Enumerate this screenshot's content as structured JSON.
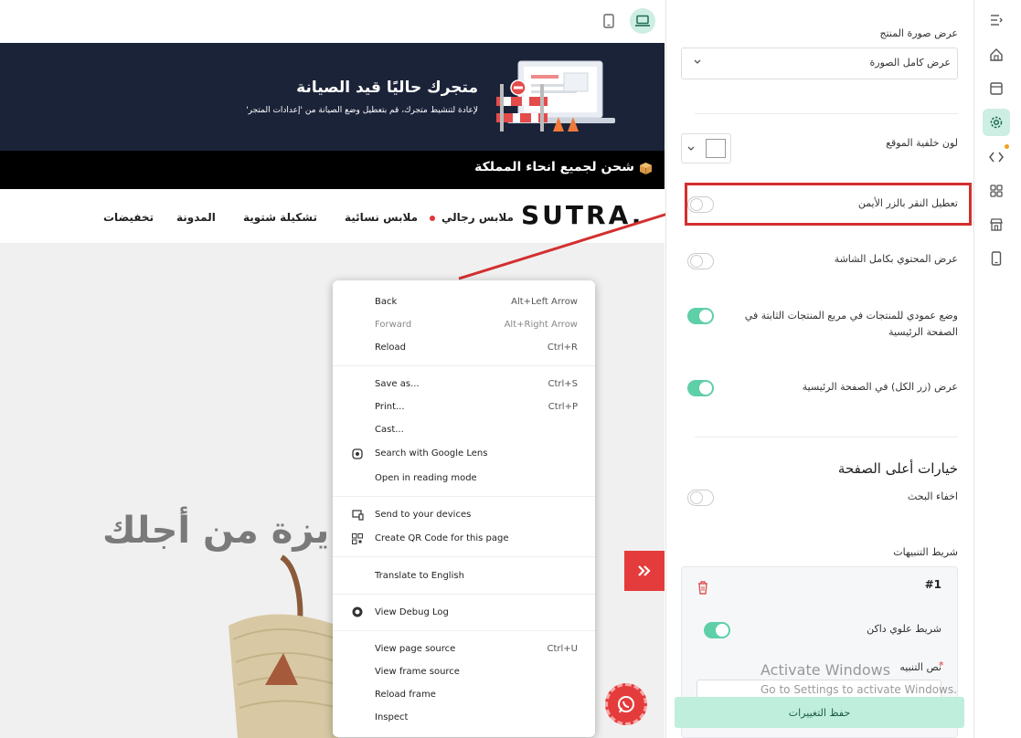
{
  "preview": {
    "maintenance": {
      "title": "متجرك حاليًا قيد الصيانة",
      "subtitle": "لإعادة لتنشيط متجرك، قم بتعطيل وضع الصيانة من 'إعدادات المتجر'"
    },
    "shipping_bar": {
      "text": "شحن لجميع انحاء المملكة",
      "icon": "box-icon"
    },
    "logo": "SUTRA.",
    "nav": [
      "ملابس رجالي",
      "ملابس نسائية",
      "تشكيلة شتوية",
      "المدونة",
      "تخفيضات"
    ],
    "hero_text": "يزة من أجلك",
    "device_buttons": {
      "mobile": "mobile-icon",
      "desktop": "desktop-icon"
    }
  },
  "context_menu": {
    "items": [
      {
        "label": "Back",
        "shortcut": "Alt+Left Arrow",
        "disabled": false
      },
      {
        "label": "Forward",
        "shortcut": "Alt+Right Arrow",
        "disabled": true
      },
      {
        "label": "Reload",
        "shortcut": "Ctrl+R",
        "disabled": false
      },
      {
        "label": "Save as...",
        "shortcut": "Ctrl+S",
        "disabled": false
      },
      {
        "label": "Print...",
        "shortcut": "Ctrl+P",
        "disabled": false
      },
      {
        "label": "Cast...",
        "shortcut": "",
        "disabled": false
      },
      {
        "label": "Search with Google Lens",
        "shortcut": "",
        "disabled": false
      },
      {
        "label": "Open in reading mode",
        "shortcut": "",
        "disabled": false
      },
      {
        "label": "Send to your devices",
        "shortcut": "",
        "disabled": false
      },
      {
        "label": "Create QR Code for this page",
        "shortcut": "",
        "disabled": false
      },
      {
        "label": "Translate to English",
        "shortcut": "",
        "disabled": false
      },
      {
        "label": "View Debug Log",
        "shortcut": "",
        "disabled": false
      },
      {
        "label": "View page source",
        "shortcut": "Ctrl+U",
        "disabled": false
      },
      {
        "label": "View frame source",
        "shortcut": "",
        "disabled": false
      },
      {
        "label": "Reload frame",
        "shortcut": "",
        "disabled": false
      },
      {
        "label": "Inspect",
        "shortcut": "",
        "disabled": false
      }
    ]
  },
  "settings": {
    "product_image_display": {
      "label": "عرض صورة المنتج",
      "value": "عرض كامل الصورة"
    },
    "site_bg_color": {
      "label": "لون خلفية الموقع",
      "color": "#ffffff"
    },
    "disable_right_click": {
      "label": "تعطيل النقر بالزر الأيمن",
      "on": false
    },
    "full_width_content": {
      "label": "عرض المحتوي بكامل الشاشة",
      "on": false
    },
    "vertical_products": {
      "label": "وضع عمودي للمنتجات في مربع المنتجات الثابتة في الصفحة الرئيسية",
      "on": true
    },
    "show_all_button": {
      "label": "عرض (زر الكل) في الصفحة الرئيسية",
      "on": true
    },
    "top_options_heading": "خيارات أعلى الصفحة",
    "hide_search": {
      "label": "اخفاء البحث",
      "on": false
    },
    "alerts_bar_label": "شريط التنبيهات",
    "alert_card": {
      "number": "#1",
      "dark_top_bar": {
        "label": "شريط علوي داكن",
        "on": true
      },
      "alert_text_label": "نص التنبيه"
    },
    "save_button": "حفظ التغييرات",
    "watermark_line1": "Activate Windows",
    "watermark_line2": "Go to Settings to activate Windows."
  },
  "sidebar_icons": [
    "list-icon",
    "home-icon",
    "layout-icon",
    "settings-icon",
    "code-icon",
    "apps-icon",
    "store-icon",
    "mobile-icon"
  ],
  "colors": {
    "accent": "#5fcfa8",
    "dark_banner": "#1b2339",
    "highlight": "#d32f2f"
  }
}
